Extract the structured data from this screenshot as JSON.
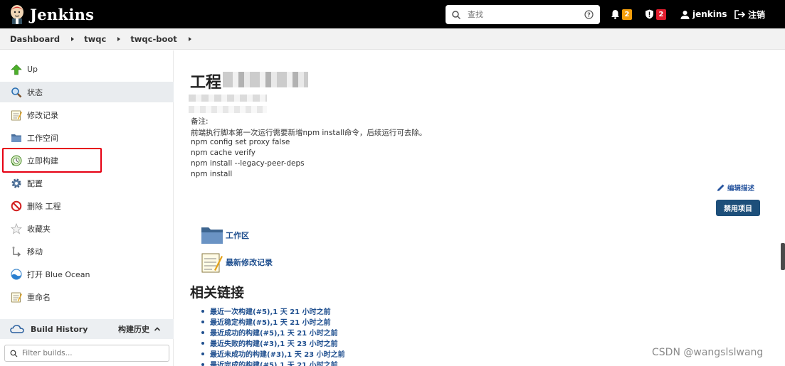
{
  "header": {
    "brand": "Jenkins",
    "search_placeholder": "查找",
    "notifications_count": "2",
    "security_count": "2",
    "user": "jenkins",
    "logout": "注销",
    "colors": {
      "notify_badge": "#f59e0b",
      "security_badge": "#e11d2e"
    }
  },
  "breadcrumb": [
    "Dashboard",
    "twqc",
    "twqc-boot"
  ],
  "sidebar": {
    "items": [
      {
        "label": "Up",
        "icon": "up-arrow-icon"
      },
      {
        "label": "状态",
        "icon": "magnifier-icon"
      },
      {
        "label": "修改记录",
        "icon": "notepad-icon"
      },
      {
        "label": "工作空间",
        "icon": "folder-icon"
      },
      {
        "label": "立即构建",
        "icon": "build-clock-icon"
      },
      {
        "label": "配置",
        "icon": "gear-icon"
      },
      {
        "label": "删除 工程",
        "icon": "no-entry-icon"
      },
      {
        "label": "收藏夹",
        "icon": "star-icon"
      },
      {
        "label": "移动",
        "icon": "move-icon"
      },
      {
        "label": "打开 Blue Ocean",
        "icon": "blue-ocean-icon"
      },
      {
        "label": "重命名",
        "icon": "notepad-icon"
      }
    ],
    "build_history": {
      "title": "Build History",
      "title_cn": "构建历史",
      "filter_placeholder": "Filter builds..."
    }
  },
  "main": {
    "title": "工程",
    "description": [
      "备注:",
      "前端执行脚本第一次运行需要新增npm install命令，后续运行可去除。",
      "npm config set proxy false",
      "npm cache verify",
      "npm install --legacy-peer-deps",
      "npm install"
    ],
    "edit_description": "编辑描述",
    "disable_project": "禁用项目",
    "links": {
      "workspace": "工作区",
      "changes": "最新修改记录"
    },
    "related_title": "相关链接",
    "related": [
      "最近一次构建(#5),1 天 21 小时之前",
      "最近稳定构建(#5),1 天 21 小时之前",
      "最近成功的构建(#5),1 天 21 小时之前",
      "最近失败的构建(#3),1 天 23 小时之前",
      "最近未成功的构建(#3),1 天 23 小时之前",
      "最近完成的构建(#5),1 天 21 小时之前"
    ]
  },
  "watermark": "CSDN @wangslslwang"
}
